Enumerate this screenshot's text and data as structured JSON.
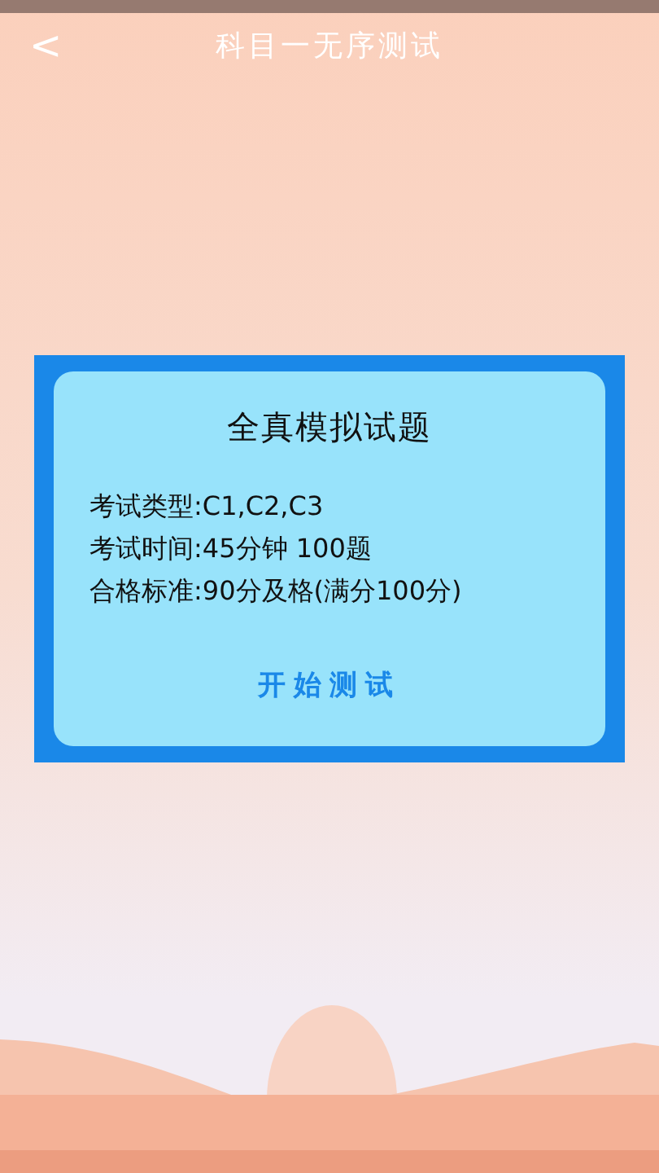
{
  "header": {
    "back": "<",
    "title": "科目一无序测试"
  },
  "card": {
    "title": "全真模拟试题",
    "lines": [
      "考试类型:C1,C2,C3",
      "考试时间:45分钟 100题",
      "合格标准:90分及格(满分100分)"
    ],
    "button": "开始测试"
  }
}
